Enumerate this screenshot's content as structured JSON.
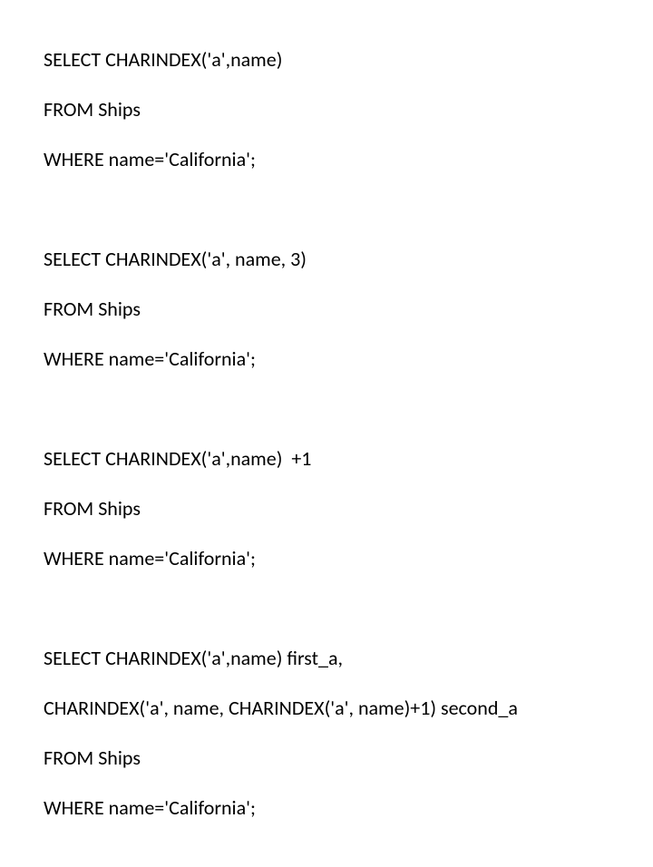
{
  "query1": {
    "l1": "SELECT CHARINDEX('a',name)",
    "l2": "FROM Ships",
    "l3": "WHERE name='California';"
  },
  "query2": {
    "l1": "SELECT CHARINDEX('a', name, 3)",
    "l2": "FROM Ships",
    "l3": "WHERE name='California';"
  },
  "query3": {
    "l1": "SELECT CHARINDEX('a',name)  +1",
    "l2": "FROM Ships",
    "l3": "WHERE name='California';"
  },
  "query4": {
    "l1": "SELECT CHARINDEX('a',name) first_a,",
    "l2": "CHARINDEX('a', name, CHARINDEX('a', name)+1) second_a",
    "l3": "FROM Ships",
    "l4": "WHERE name='California';"
  }
}
